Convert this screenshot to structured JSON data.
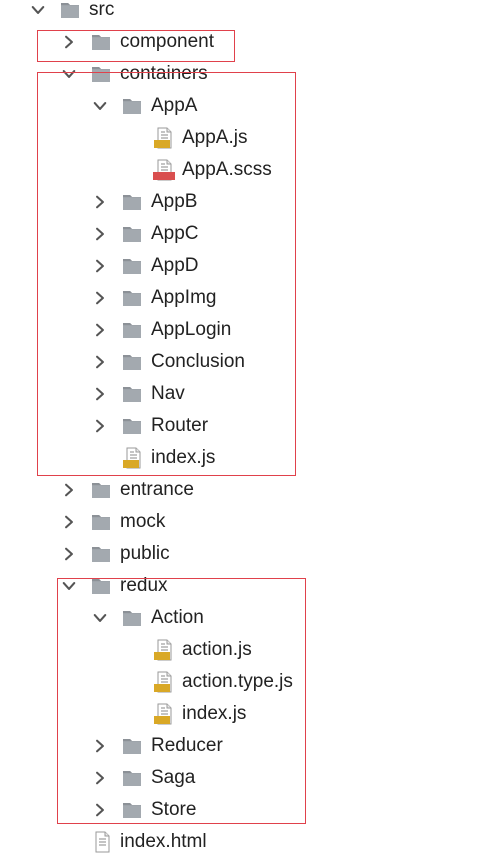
{
  "tree": {
    "root": {
      "label": "src",
      "icon": "folder-icon",
      "expanded": true
    },
    "items": {
      "component": {
        "label": "component",
        "icon": "folder-icon",
        "expanded": false
      },
      "containers": {
        "label": "containers",
        "icon": "folder-icon",
        "expanded": true
      },
      "appa": {
        "label": "AppA",
        "icon": "folder-icon",
        "expanded": true
      },
      "appa_js": {
        "label": "AppA.js",
        "icon": "js-file-icon",
        "badge": "JS"
      },
      "appa_scss": {
        "label": "AppA.scss",
        "icon": "sass-file-icon",
        "badge": "SASS"
      },
      "appb": {
        "label": "AppB",
        "icon": "folder-icon",
        "expanded": false
      },
      "appc": {
        "label": "AppC",
        "icon": "folder-icon",
        "expanded": false
      },
      "appd": {
        "label": "AppD",
        "icon": "folder-icon",
        "expanded": false
      },
      "appimg": {
        "label": "AppImg",
        "icon": "folder-icon",
        "expanded": false
      },
      "applogin": {
        "label": "AppLogin",
        "icon": "folder-icon",
        "expanded": false
      },
      "conclusion": {
        "label": "Conclusion",
        "icon": "folder-icon",
        "expanded": false
      },
      "nav": {
        "label": "Nav",
        "icon": "folder-icon",
        "expanded": false
      },
      "router": {
        "label": "Router",
        "icon": "folder-icon",
        "expanded": false
      },
      "containers_index": {
        "label": "index.js",
        "icon": "js-file-icon",
        "badge": "JS"
      },
      "entrance": {
        "label": "entrance",
        "icon": "folder-icon",
        "expanded": false
      },
      "mock": {
        "label": "mock",
        "icon": "folder-icon",
        "expanded": false
      },
      "public": {
        "label": "public",
        "icon": "folder-icon",
        "expanded": false
      },
      "redux": {
        "label": "redux",
        "icon": "folder-icon",
        "expanded": true
      },
      "action": {
        "label": "Action",
        "icon": "folder-icon",
        "expanded": true
      },
      "action_js": {
        "label": "action.js",
        "icon": "js-file-icon",
        "badge": "JS"
      },
      "action_type_js": {
        "label": "action.type.js",
        "icon": "js-file-icon",
        "badge": "JS"
      },
      "action_index_js": {
        "label": "index.js",
        "icon": "js-file-icon",
        "badge": "JS"
      },
      "reducer": {
        "label": "Reducer",
        "icon": "folder-icon",
        "expanded": false
      },
      "saga": {
        "label": "Saga",
        "icon": "folder-icon",
        "expanded": false
      },
      "store": {
        "label": "Store",
        "icon": "folder-icon",
        "expanded": false
      },
      "index_html": {
        "label": "index.html",
        "icon": "html-file-icon"
      }
    }
  },
  "colors": {
    "folder": "#9ea4aa",
    "folder_tab": "#8c9197",
    "chevron": "#555555",
    "js_badge": "#d9a826",
    "sass_badge": "#d94f4f",
    "highlight_border": "#e0414b",
    "text": "#222222"
  }
}
